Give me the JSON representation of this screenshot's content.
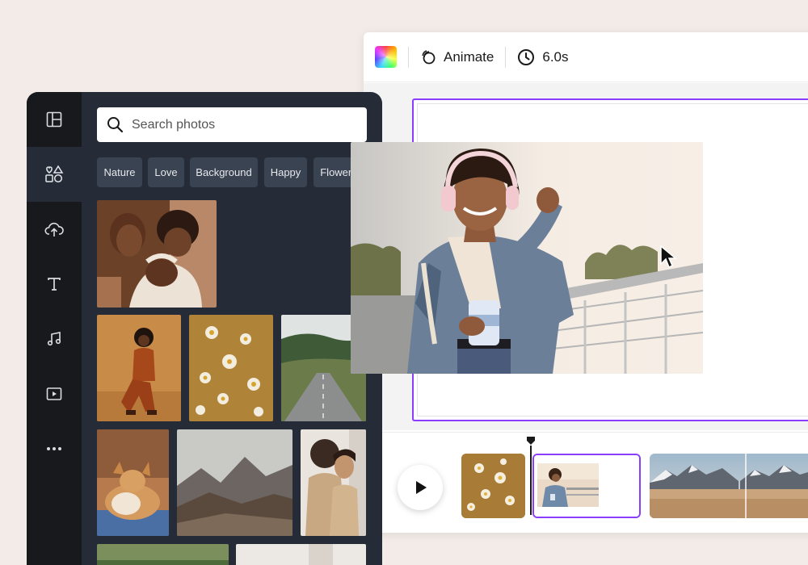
{
  "toolbar": {
    "color_icon": "rainbow-color-swatch",
    "animate_label": "Animate",
    "animate_icon": "animate-icon",
    "duration_label": "6.0s",
    "duration_icon": "clock-icon"
  },
  "search": {
    "placeholder": "Search photos",
    "value": "",
    "icon": "search-icon"
  },
  "rail": {
    "items": [
      {
        "icon": "templates-icon",
        "active": false
      },
      {
        "icon": "elements-icon",
        "active": true
      },
      {
        "icon": "uploads-icon",
        "active": false
      },
      {
        "icon": "text-icon",
        "active": false
      },
      {
        "icon": "audio-icon",
        "active": false
      },
      {
        "icon": "video-icon",
        "active": false
      },
      {
        "icon": "more-icon",
        "active": false
      }
    ]
  },
  "chips": [
    "Nature",
    "Love",
    "Background",
    "Happy",
    "Flowers"
  ],
  "timeline": {
    "play_icon": "play-icon",
    "clips": [
      "daisies-clip",
      "woman-headphones-clip",
      "mountains-clip"
    ]
  },
  "colors": {
    "accent": "#8b3dff",
    "panel": "#252c37",
    "rail": "#18191d",
    "chip": "#3a4351"
  }
}
